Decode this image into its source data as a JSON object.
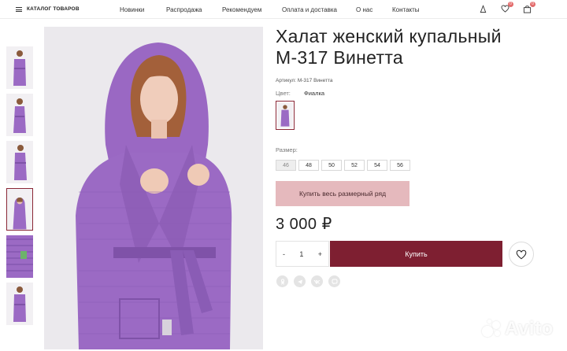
{
  "header": {
    "catalog_label": "КАТАЛОГ ТОВАРОВ",
    "nav": [
      "Новинки",
      "Распродажа",
      "Рекомендуем",
      "Оплата и доставка",
      "О нас",
      "Контакты"
    ],
    "icons": {
      "account": "user-icon",
      "favorites": "heart-icon",
      "cart": "bag-icon"
    },
    "favorites_count": "0",
    "cart_count": "0"
  },
  "product": {
    "title_line1": "Халат женский купальный",
    "title_line2": "М-317 Винетта",
    "sku": "Артикул: М-317 Винетта",
    "color_label": "Цвет:",
    "color_value": "Фиалка",
    "size_label": "Размер:",
    "sizes": [
      "46",
      "48",
      "50",
      "52",
      "54",
      "56"
    ],
    "selected_size": "46",
    "buy_size_range_label": "Купить весь размерный ряд",
    "price": "3 000 ₽",
    "quantity": "1",
    "qty_minus": "-",
    "qty_plus": "+",
    "buy_label": "Купить",
    "share_icons": [
      "odnoklassniki-icon",
      "telegram-icon",
      "vk-icon",
      "viber-icon"
    ]
  },
  "colors": {
    "accent": "#7e1f31",
    "pink_button": "#e5b9bd",
    "robe_purple": "#9b6ac4"
  },
  "gallery": {
    "thumbnail_count": 6,
    "active_index": 3
  },
  "watermark": "Avito"
}
